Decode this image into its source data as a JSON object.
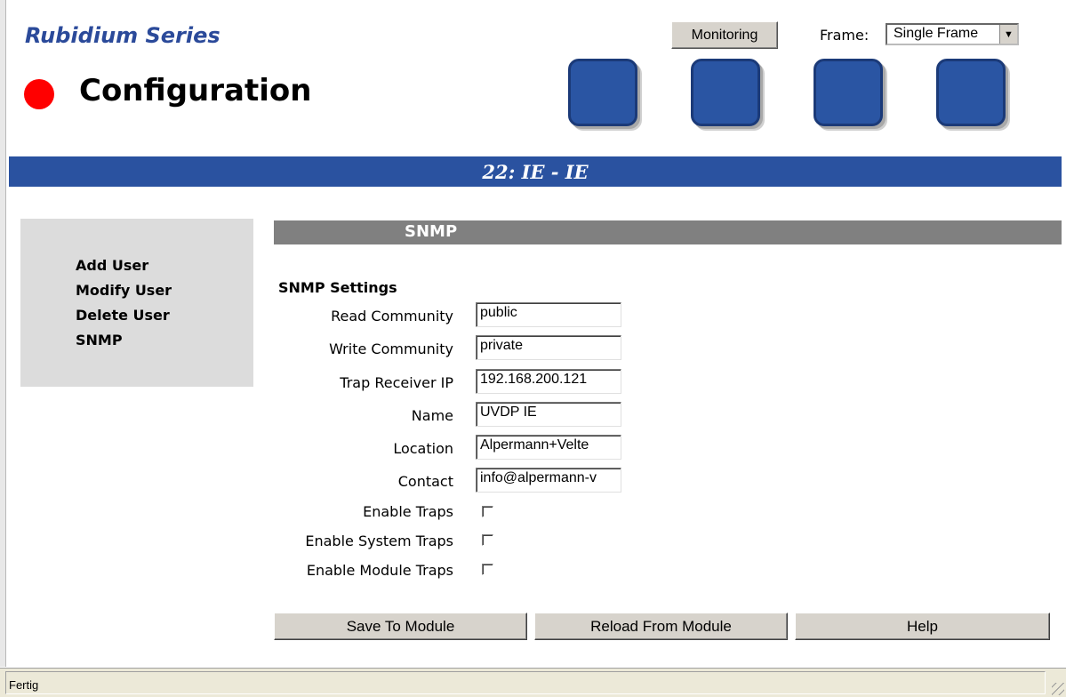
{
  "brand": "Rubidium Series",
  "page_title": "Configuration",
  "header": {
    "monitoring_label": "Monitoring",
    "frame_label": "Frame:",
    "frame_value": "Single Frame"
  },
  "banner": "22: IE - IE",
  "sidebar": {
    "items": [
      {
        "label": "Add User"
      },
      {
        "label": "Modify User"
      },
      {
        "label": "Delete User"
      },
      {
        "label": "SNMP"
      }
    ]
  },
  "section": {
    "title": "SNMP",
    "settings_title": "SNMP Settings",
    "fields": [
      {
        "label": "Read Community",
        "value": "public"
      },
      {
        "label": "Write Community",
        "value": "private"
      },
      {
        "label": "Trap Receiver IP",
        "value": "192.168.200.121"
      },
      {
        "label": "Name",
        "value": "UVDP IE"
      },
      {
        "label": "Location",
        "value": "Alpermann+Velte"
      },
      {
        "label": "Contact",
        "value": "info@alpermann-v"
      }
    ],
    "checkboxes": [
      {
        "label": "Enable Traps",
        "checked": false
      },
      {
        "label": "Enable System Traps",
        "checked": false
      },
      {
        "label": "Enable Module Traps",
        "checked": false
      }
    ]
  },
  "actions": {
    "save": "Save To Module",
    "reload": "Reload From Module",
    "help": "Help"
  },
  "colors": {
    "brand_text": "#2b4a9a",
    "status_dot": "#ff0000",
    "banner": "#2a52a0",
    "tile": "#2a55a3",
    "section_bar": "#808080"
  },
  "statusbar": {
    "text": "Fertig"
  }
}
